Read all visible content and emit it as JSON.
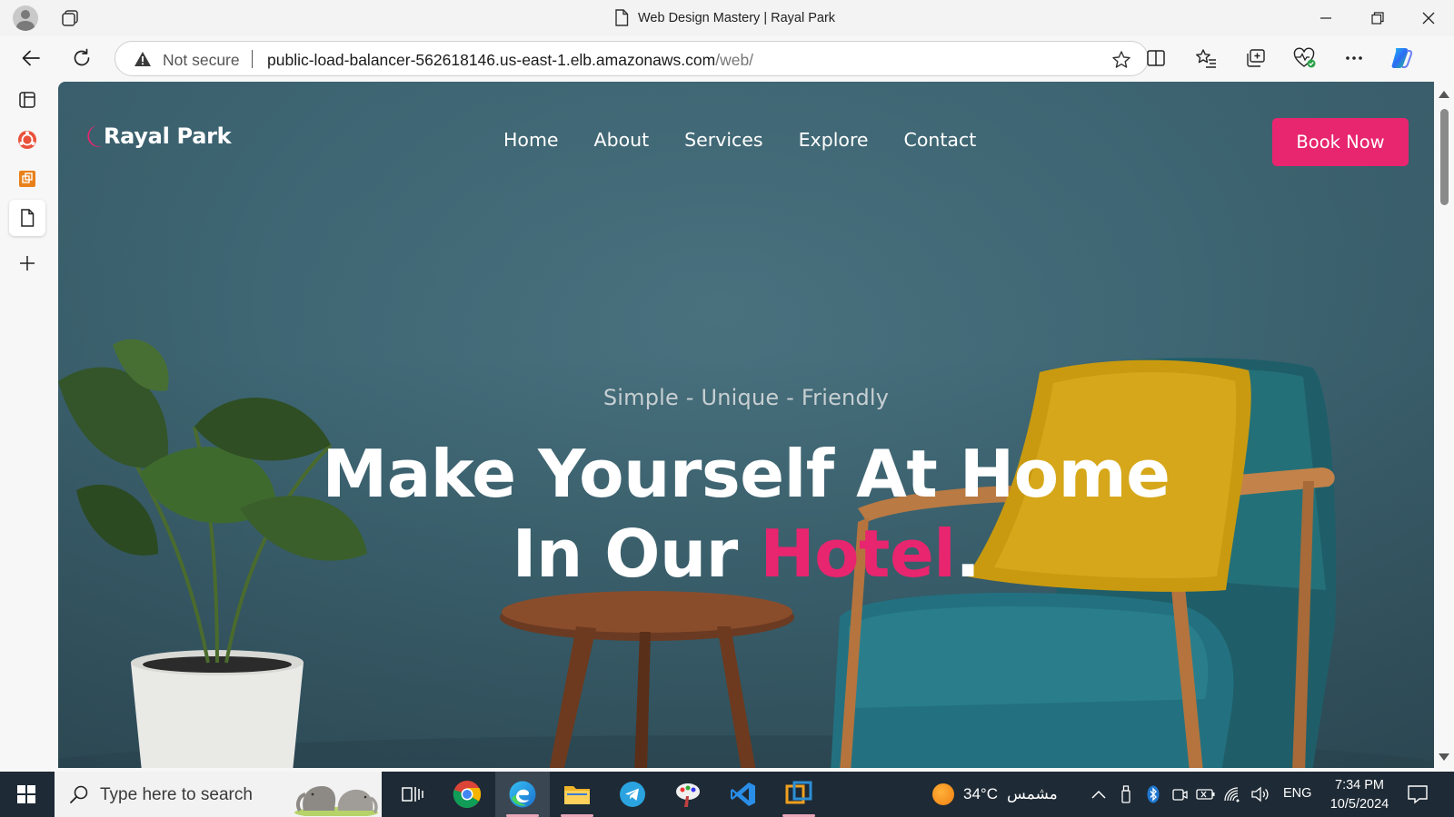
{
  "browser": {
    "window_title": "Web Design Mastery | Rayal Park",
    "security_label": "Not secure",
    "url_host": "public-load-balancer-562618146.us-east-1.elb.amazonaws.com",
    "url_path": "/web/"
  },
  "site": {
    "logo_text": "Rayal Park",
    "nav": [
      "Home",
      "About",
      "Services",
      "Explore",
      "Contact"
    ],
    "cta_label": "Book Now",
    "hero_subtitle": "Simple - Unique - Friendly",
    "hero_line1": "Make Yourself At Home",
    "hero_line2_prefix": "In Our ",
    "hero_line2_accent": "Hotel",
    "hero_line2_suffix": ".",
    "accent_color": "#e8256f"
  },
  "taskbar": {
    "search_placeholder": "Type here to search",
    "weather_temp": "34°C",
    "weather_condition": "مشمس",
    "language": "ENG",
    "time": "7:34 PM",
    "date": "10/5/2024"
  }
}
